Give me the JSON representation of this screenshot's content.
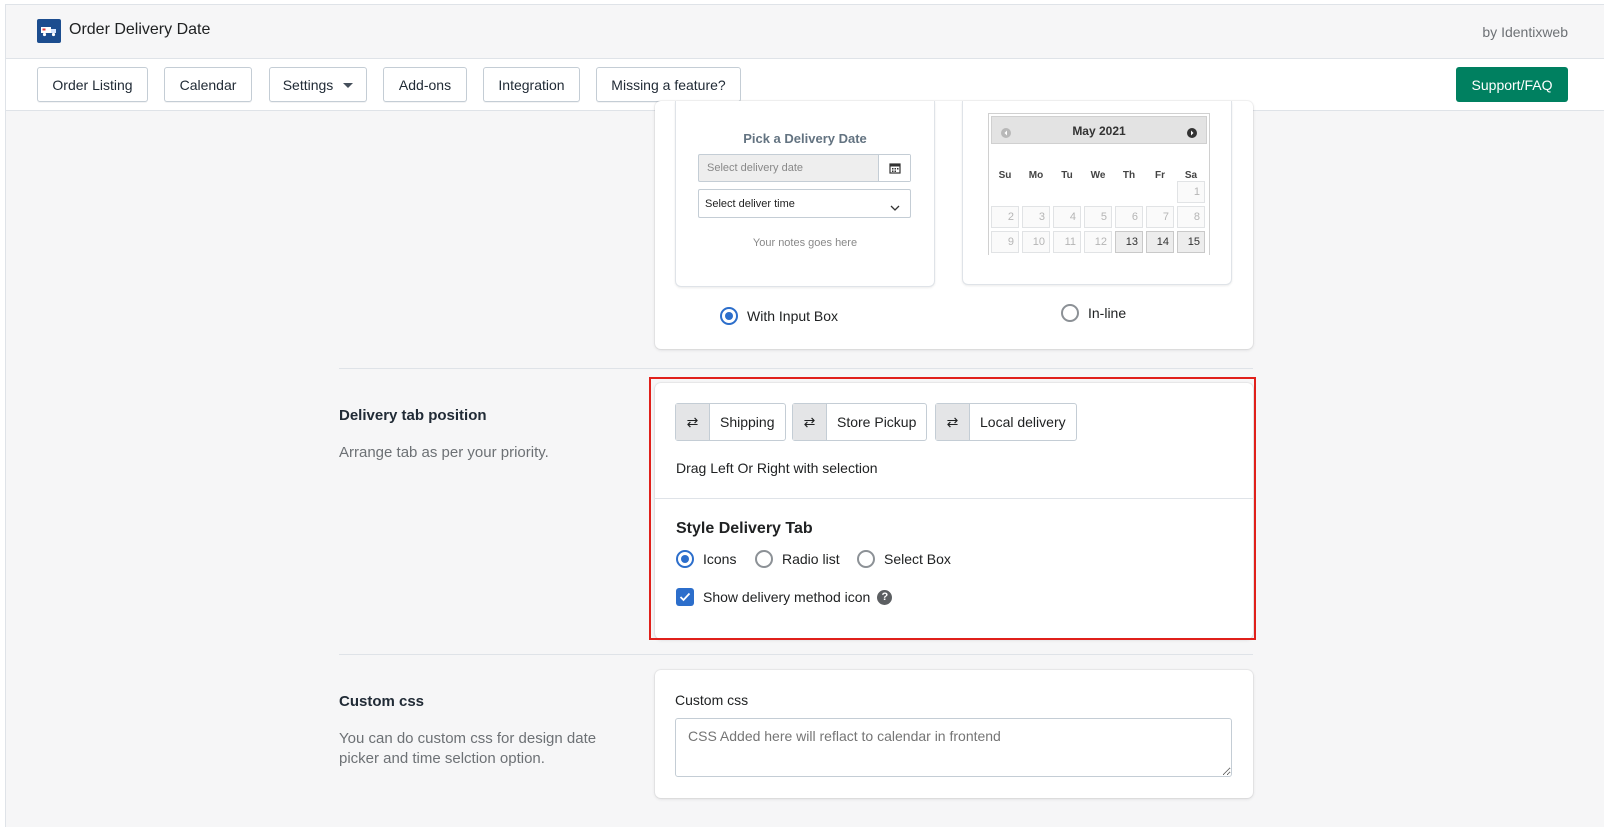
{
  "app": {
    "title": "Order Delivery Date",
    "byline": "by Identixweb"
  },
  "nav": {
    "items": [
      "Order Listing",
      "Calendar",
      "Settings",
      "Add-ons",
      "Integration",
      "Missing a feature?"
    ],
    "support": "Support/FAQ"
  },
  "picker": {
    "heading": "Pick a Delivery Date",
    "date_placeholder": "Select delivery date",
    "time_placeholder": "Select deliver time",
    "notes": "Your notes goes here",
    "option_input": "With Input Box",
    "option_inline": "In-line",
    "selected": "With Input Box"
  },
  "calendar": {
    "month": "May 2021",
    "weekdays": [
      "Su",
      "Mo",
      "Tu",
      "We",
      "Th",
      "Fr",
      "Sa"
    ],
    "days": [
      "1",
      "2",
      "3",
      "4",
      "5",
      "6",
      "7",
      "8",
      "9",
      "10",
      "11",
      "12",
      "13",
      "14",
      "15"
    ],
    "enabled_days": [
      "13",
      "14",
      "15"
    ]
  },
  "delivery_tab": {
    "title": "Delivery tab position",
    "desc": "Arrange tab as per your priority.",
    "tabs": [
      "Shipping",
      "Store Pickup",
      "Local delivery"
    ],
    "drag_hint": "Drag Left Or Right with selection",
    "drag_glyph": "⇄",
    "style_title": "Style Delivery Tab",
    "style_options": [
      "Icons",
      "Radio list",
      "Select Box"
    ],
    "style_selected": "Icons",
    "show_icon_label": "Show delivery method icon",
    "show_icon_checked": true,
    "highlight_color": "#e0201b"
  },
  "custom_css": {
    "title": "Custom css",
    "desc": "You can do custom css for design date picker and time selction option.",
    "field_label": "Custom css",
    "placeholder": "CSS Added here will reflact to calendar in frontend"
  },
  "colors": {
    "accent": "#2c6ecb",
    "primary": "#008060"
  }
}
